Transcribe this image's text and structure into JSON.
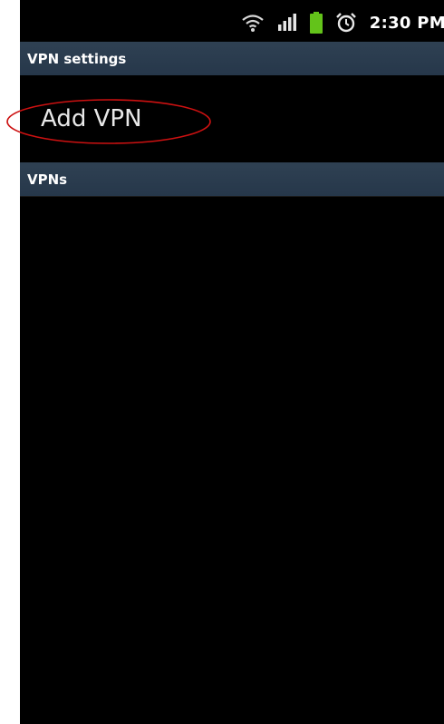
{
  "status_bar": {
    "time": "2:30 PM",
    "icons": [
      "wifi-icon",
      "signal-icon",
      "battery-icon",
      "alarm-icon"
    ],
    "battery_color": "#63c31a"
  },
  "header": {
    "title": "VPN settings"
  },
  "list": {
    "add_vpn_label": "Add VPN"
  },
  "vpns_section": {
    "title": "VPNs"
  },
  "annotation": {
    "color": "#cc1111"
  }
}
